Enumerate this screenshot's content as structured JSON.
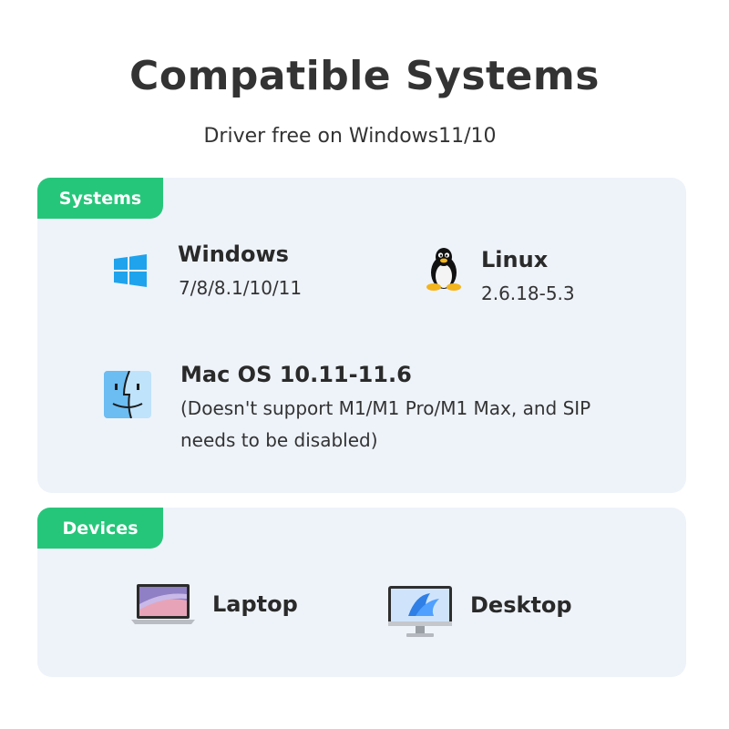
{
  "header": {
    "title": "Compatible Systems",
    "subtitle": "Driver free on Windows11/10"
  },
  "systems": {
    "badge": "Systems",
    "windows": {
      "name": "Windows",
      "versions": "7/8/8.1/10/11",
      "icon": "windows-logo-icon"
    },
    "linux": {
      "name": "Linux",
      "versions": "2.6.18-5.3",
      "icon": "tux-penguin-icon"
    },
    "mac": {
      "name": "Mac OS 10.11-11.6",
      "note_line1": "(Doesn't support M1/M1 Pro/M1 Max, and SIP",
      "note_line2": "needs to be disabled)",
      "icon": "mac-finder-icon"
    }
  },
  "devices": {
    "badge": "Devices",
    "laptop": {
      "label": "Laptop",
      "icon": "laptop-icon"
    },
    "desktop": {
      "label": "Desktop",
      "icon": "desktop-monitor-icon"
    }
  },
  "colors": {
    "accent": "#26c67a",
    "card_bg": "#eef3fa",
    "windows_blue": "#1fa3ec"
  }
}
